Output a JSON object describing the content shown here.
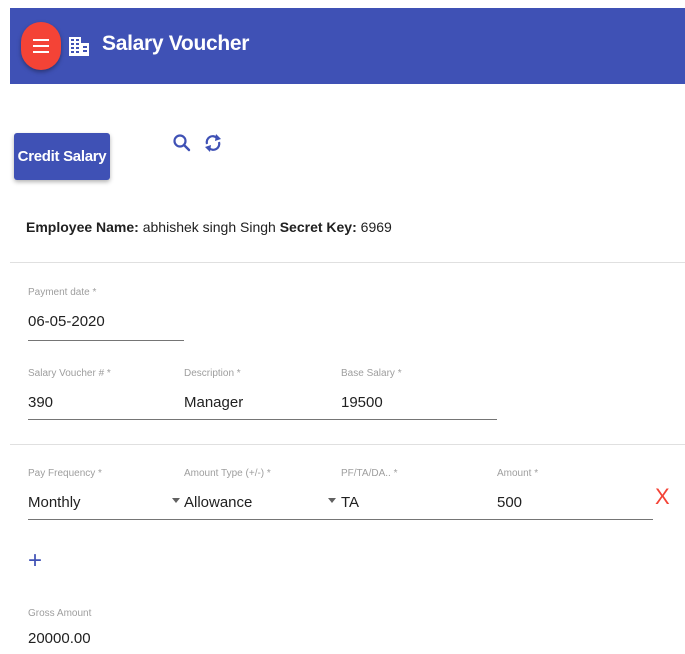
{
  "header": {
    "title": "Salary Voucher",
    "menu_icon": "menu-icon",
    "page_icon": "building-icon"
  },
  "toolbar": {
    "credit_salary_label": "Credit Salary",
    "search_icon": "search-icon",
    "refresh_icon": "refresh-icon"
  },
  "employee": {
    "name_label": "Employee Name:",
    "name_value": "abhishek singh Singh",
    "key_label": "Secret Key:",
    "key_value": "6969"
  },
  "form": {
    "payment_date": {
      "label": "Payment date *",
      "value": "06-05-2020"
    },
    "voucher_no": {
      "label": "Salary Voucher # *",
      "value": "390"
    },
    "description": {
      "label": "Description *",
      "value": "Manager"
    },
    "base_salary": {
      "label": "Base Salary *",
      "value": "19500"
    }
  },
  "line_item": {
    "pay_frequency": {
      "label": "Pay Frequency *",
      "value": "Monthly"
    },
    "amount_type": {
      "label": "Amount Type (+/-) *",
      "value": "Allowance"
    },
    "pf_ta_da": {
      "label": "PF/TA/DA.. *",
      "value": "TA"
    },
    "amount": {
      "label": "Amount *",
      "value": "500"
    },
    "remove_symbol": "X",
    "add_symbol": "+"
  },
  "gross": {
    "label": "Gross Amount",
    "value": "20000.00"
  },
  "colors": {
    "primary": "#3f51b5",
    "accent": "#f44336"
  }
}
